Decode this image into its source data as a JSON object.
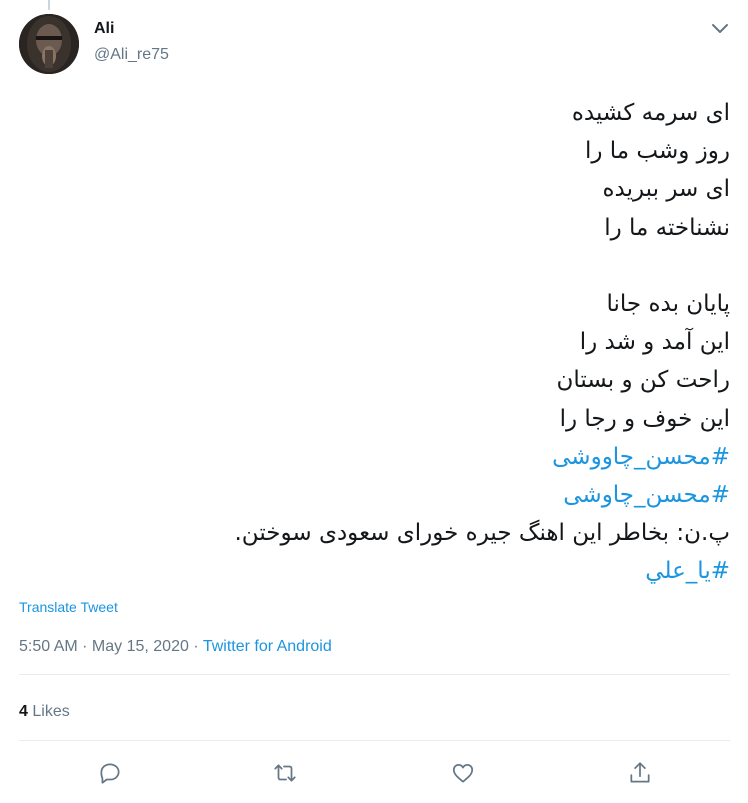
{
  "author": {
    "name": "Ali",
    "handle": "@Ali_re75"
  },
  "tweet": {
    "lines": [
      "ای سرمه کشیده",
      "روز وشب ما را",
      "ای سر ببریده",
      "نشناخته ما را",
      "",
      "پایان بده جانا",
      "این آمد و شد را",
      "راحت کن و بستان",
      "این خوف و رجا را"
    ],
    "hashtag_1": "#محسن_چاووشی",
    "hashtag_2": "#محسن_چاوشی",
    "footnote": "پ.ن: بخاطر این اهنگ جیره خورای سعودی سوختن.",
    "hashtag_3": "#يا_علي"
  },
  "translate_label": "Translate Tweet",
  "meta": {
    "timestamp": "5:50 AM · May 15, 2020",
    "separator": " · ",
    "source": "Twitter for Android"
  },
  "stats": {
    "likes_count": "4",
    "likes_label": "Likes"
  },
  "actions": [
    "reply-icon",
    "retweet-icon",
    "like-icon",
    "share-icon"
  ],
  "colors": {
    "link": "#1b95e0",
    "text": "#14171a",
    "muted": "#657786",
    "divider": "#e6ecf0"
  }
}
